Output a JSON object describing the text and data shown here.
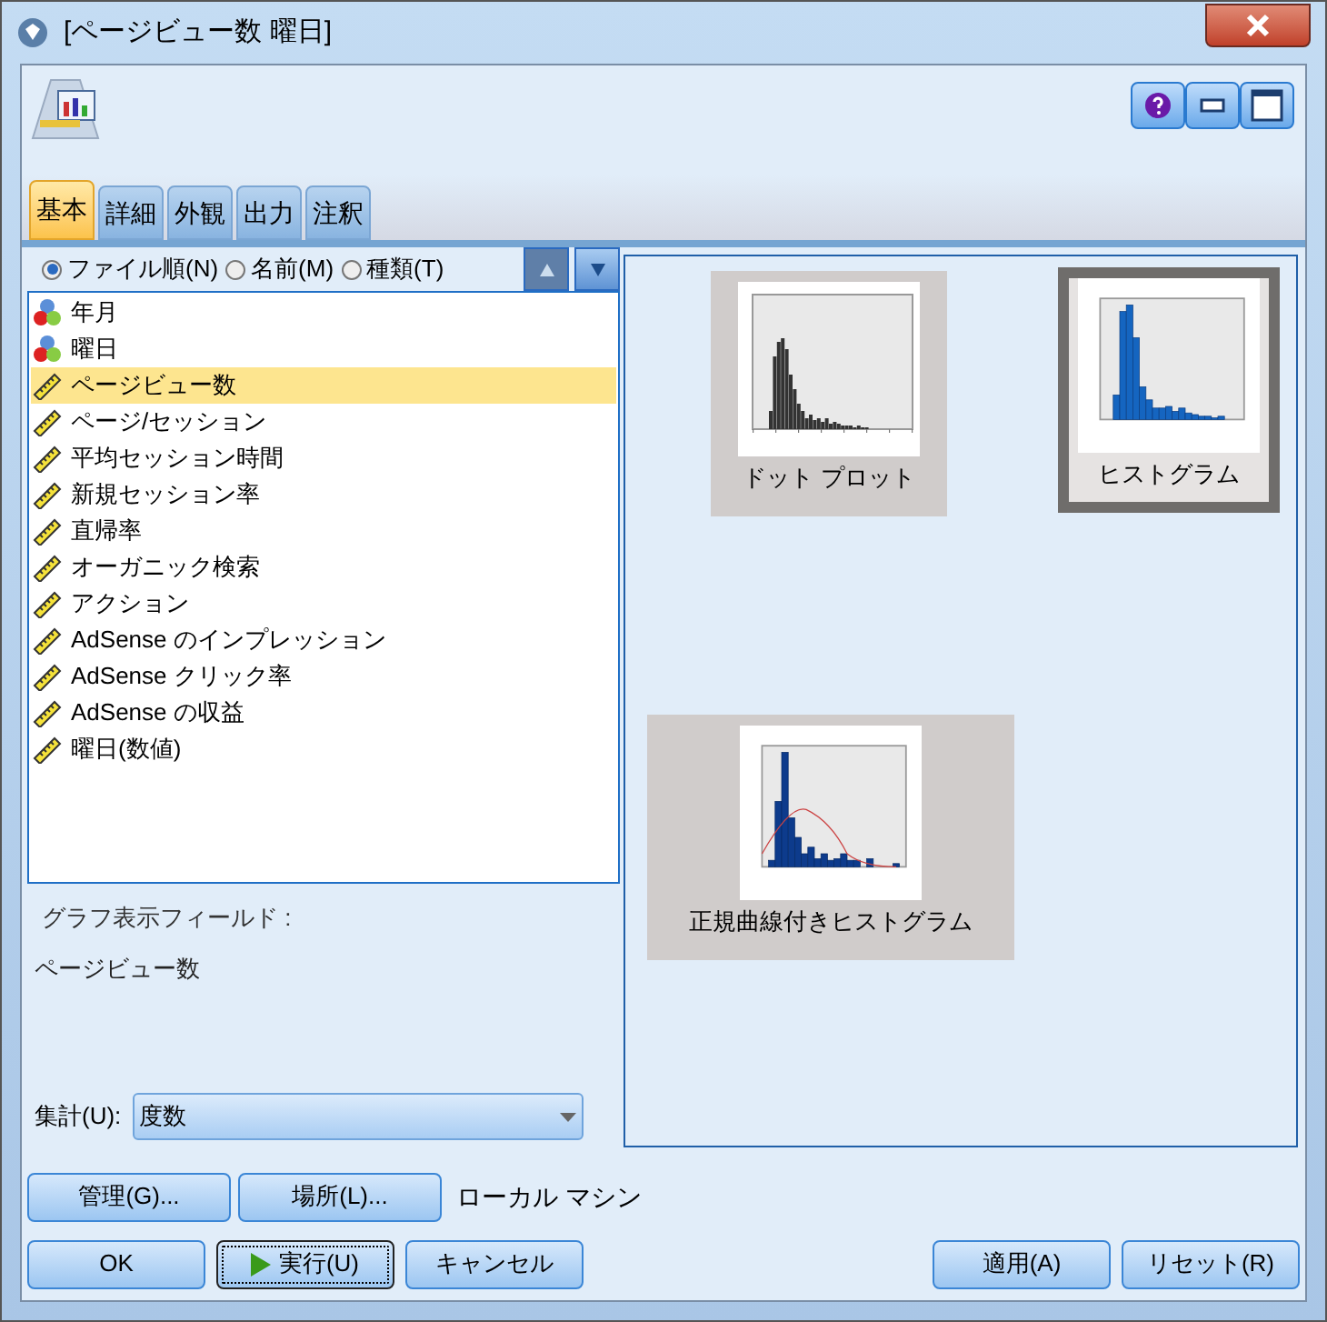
{
  "window": {
    "title": "[ページビュー数 曜日]"
  },
  "tabs": [
    {
      "label": "基本",
      "selected": true
    },
    {
      "label": "詳細",
      "selected": false
    },
    {
      "label": "外観",
      "selected": false
    },
    {
      "label": "出力",
      "selected": false
    },
    {
      "label": "注釈",
      "selected": false
    }
  ],
  "sort_options": [
    {
      "label": "ファイル順(N)",
      "selected": true
    },
    {
      "label": "名前(M)",
      "selected": false
    },
    {
      "label": "種類(T)",
      "selected": false
    }
  ],
  "fields": [
    {
      "label": "年月",
      "kind": "set",
      "selected": false
    },
    {
      "label": "曜日",
      "kind": "set",
      "selected": false
    },
    {
      "label": "ページビュー数",
      "kind": "range",
      "selected": true
    },
    {
      "label": "ページ/セッション",
      "kind": "range",
      "selected": false
    },
    {
      "label": "平均セッション時間",
      "kind": "range",
      "selected": false
    },
    {
      "label": "新規セッション率",
      "kind": "range",
      "selected": false
    },
    {
      "label": "直帰率",
      "kind": "range",
      "selected": false
    },
    {
      "label": "オーガニック検索",
      "kind": "range",
      "selected": false
    },
    {
      "label": "アクション",
      "kind": "range",
      "selected": false
    },
    {
      "label": "AdSense のインプレッション",
      "kind": "range",
      "selected": false
    },
    {
      "label": "AdSense クリック率",
      "kind": "range",
      "selected": false
    },
    {
      "label": "AdSense の収益",
      "kind": "range",
      "selected": false
    },
    {
      "label": "曜日(数値)",
      "kind": "range",
      "selected": false
    }
  ],
  "graph_fields_label": "グラフ表示フィールド :",
  "graph_fields_value": "ページビュー数",
  "aggregate": {
    "label": "集計(U):",
    "value": "度数"
  },
  "graphs": [
    {
      "label": "ドット プロット",
      "kind": "dot",
      "selected": false
    },
    {
      "label": "ヒストグラム",
      "kind": "histogram",
      "selected": true
    },
    {
      "label": "正規曲線付きヒストグラム",
      "kind": "normal",
      "selected": false
    }
  ],
  "buttons_row1": [
    "管理(G)...",
    "場所(L)..."
  ],
  "location": "ローカル マシン",
  "buttons_left": [
    "OK",
    "実行(U)",
    "キャンセル"
  ],
  "buttons_right": [
    "適用(A)",
    "リセット(R)"
  ]
}
